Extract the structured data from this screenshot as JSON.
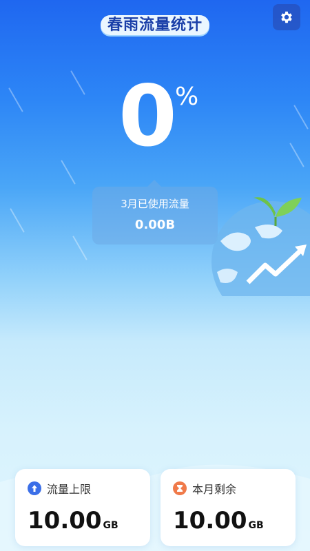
{
  "header": {
    "title": "春雨流量统计",
    "settings_icon": "gear-icon"
  },
  "usage": {
    "percent_value": "0",
    "percent_sign": "%",
    "month_label": "3月已使用流量",
    "used_value": "0.00B"
  },
  "cards": {
    "limit": {
      "label": "流量上限",
      "value": "10.00",
      "unit": "GB",
      "icon": "upload-arrow-icon",
      "icon_color": "#3b6fe8"
    },
    "remaining": {
      "label": "本月剩余",
      "value": "10.00",
      "unit": "GB",
      "icon": "hourglass-icon",
      "icon_color": "#f07a4a"
    }
  },
  "colors": {
    "accent": "#1f67f0",
    "card_bg": "#ffffff"
  }
}
